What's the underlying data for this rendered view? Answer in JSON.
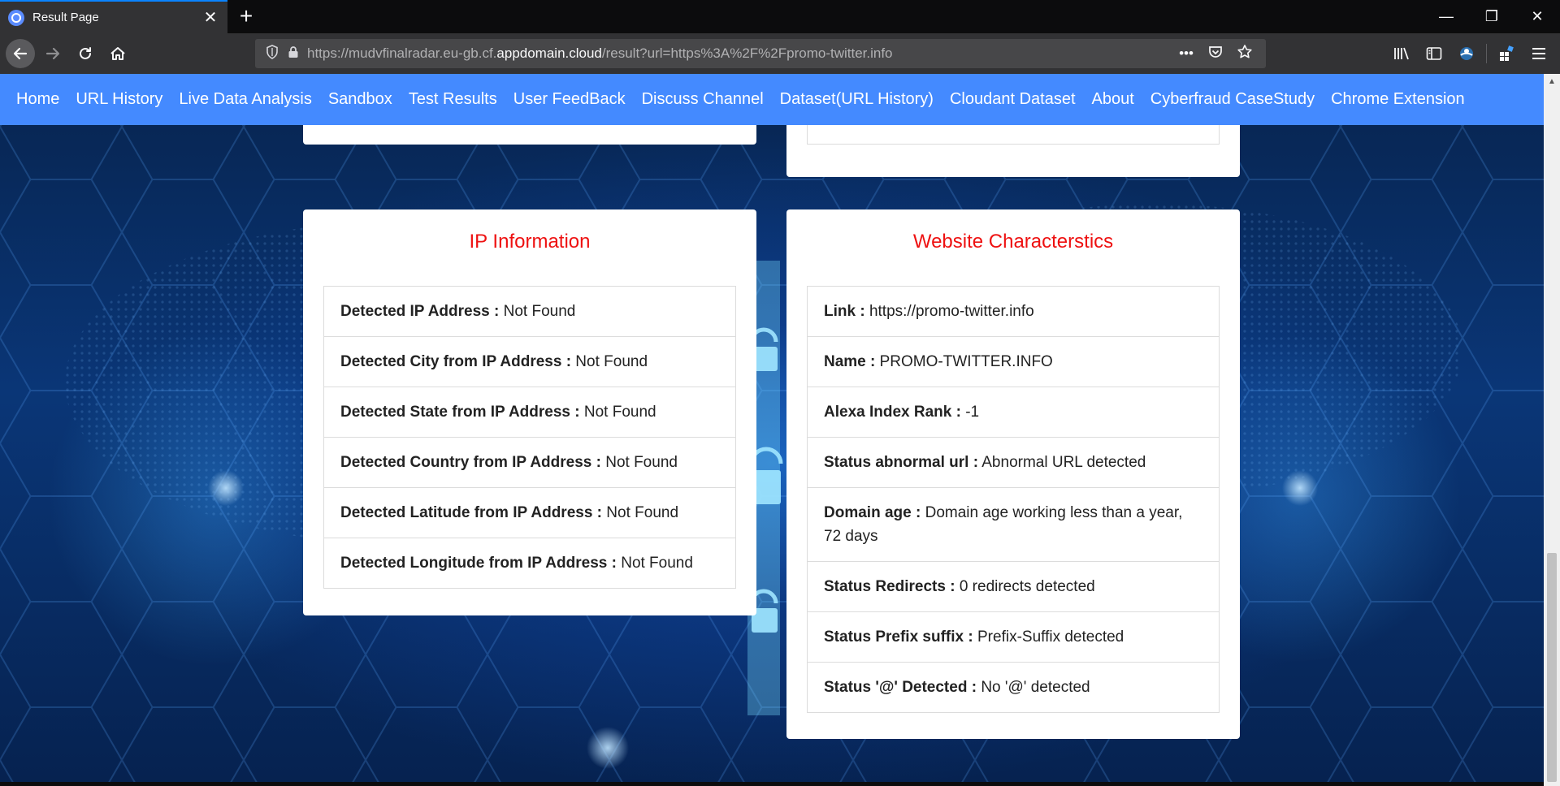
{
  "browser": {
    "tab_title": "Result Page",
    "tab_close": "✕",
    "new_tab": "+",
    "url_dim_prefix": "https://mudvfinalradar.eu-gb.cf.",
    "url_domain": "appdomain.cloud",
    "url_path": "/result?url=https%3A%2F%2Fpromo-twitter.info",
    "window_controls": {
      "minimize": "—",
      "restore": "❐",
      "close": "✕"
    }
  },
  "site_nav": {
    "items": [
      "Home",
      "URL History",
      "Live Data Analysis",
      "Sandbox",
      "Test Results",
      "User FeedBack",
      "Discuss Channel",
      "Dataset(URL History)",
      "Cloudant Dataset",
      "About",
      "Cyberfraud CaseStudy",
      "Chrome Extension"
    ]
  },
  "ip_card": {
    "title": "IP Information",
    "items": [
      {
        "label": "Detected IP Address :",
        "value": " Not Found"
      },
      {
        "label": "Detected City from IP Address :",
        "value": " Not Found"
      },
      {
        "label": "Detected State from IP Address :",
        "value": " Not Found"
      },
      {
        "label": "Detected Country from IP Address :",
        "value": " Not Found"
      },
      {
        "label": "Detected Latitude from IP Address :",
        "value": " Not Found"
      },
      {
        "label": "Detected Longitude from IP Address :",
        "value": " Not Found"
      }
    ]
  },
  "website_card": {
    "title": "Website Characterstics",
    "items": [
      {
        "label": "Link :",
        "value": " https://promo-twitter.info"
      },
      {
        "label": "Name :",
        "value": " PROMO-TWITTER.INFO"
      },
      {
        "label": "Alexa Index Rank :",
        "value": " -1"
      },
      {
        "label": "Status abnormal url :",
        "value": " Abnormal URL detected"
      },
      {
        "label": "Domain age :",
        "value": " Domain age working less than a year, 72 days"
      },
      {
        "label": "Status Redirects :",
        "value": " 0 redirects detected"
      },
      {
        "label": "Status Prefix suffix :",
        "value": " Prefix-Suffix detected"
      },
      {
        "label": "Status '@' Detected :",
        "value": " No '@' detected"
      }
    ]
  },
  "colors": {
    "nav_bar": "#448aff",
    "card_title": "#ee1111",
    "chrome_dark": "#323234"
  }
}
